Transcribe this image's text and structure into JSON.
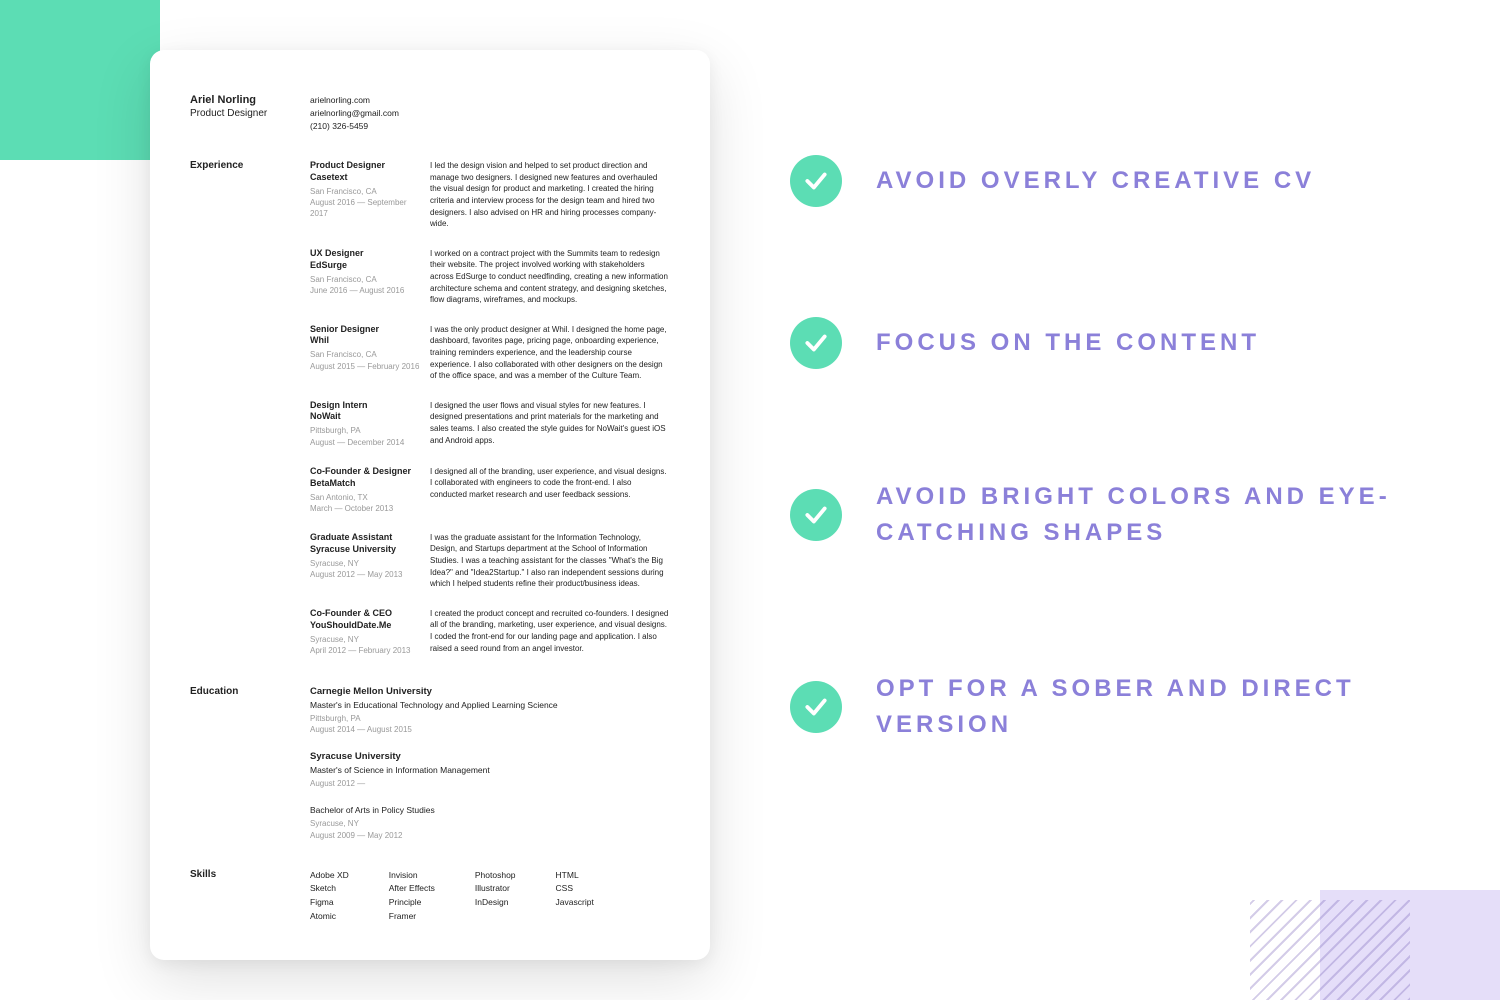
{
  "colors": {
    "accent": "#5CDDB4",
    "tip": "#8B80D9",
    "corner": "#E5DEF9"
  },
  "resume": {
    "name": "Ariel Norling",
    "role": "Product Designer",
    "contact": {
      "site": "arielnorling.com",
      "email": "arielnorling@gmail.com",
      "phone": "(210) 326-5459"
    },
    "sections": {
      "experience_label": "Experience",
      "education_label": "Education",
      "skills_label": "Skills"
    },
    "experience": [
      {
        "title": "Product Designer",
        "company": "Casetext",
        "location": "San Francisco, CA",
        "dates": "August 2016 — September 2017",
        "desc": "I led the design vision and helped to set product direction and manage two designers. I designed new features and overhauled the visual design for product and marketing. I created the hiring criteria and interview process for the design team and hired two designers. I also advised on HR and hiring processes company-wide."
      },
      {
        "title": "UX Designer",
        "company": "EdSurge",
        "location": "San Francisco, CA",
        "dates": "June 2016 — August 2016",
        "desc": "I worked on a contract project with the Summits team to redesign their website. The project involved working with stakeholders across EdSurge to conduct needfinding, creating a new information architecture schema and content strategy, and designing sketches, flow diagrams, wireframes, and mockups."
      },
      {
        "title": "Senior Designer",
        "company": "Whil",
        "location": "San Francisco, CA",
        "dates": "August 2015 — February 2016",
        "desc": "I was the only product designer at Whil. I designed the home page, dashboard, favorites page, pricing page, onboarding experience, training reminders experience, and the leadership course experience. I also collaborated with other designers on the design of the office space, and was a member of the Culture Team."
      },
      {
        "title": "Design Intern",
        "company": "NoWait",
        "location": "Pittsburgh, PA",
        "dates": "August — December 2014",
        "desc": "I designed the user flows and visual styles for new features. I designed presentations and print materials for the marketing and sales teams. I also created the style guides for NoWait's guest iOS and Android apps."
      },
      {
        "title": "Co-Founder & Designer",
        "company": "BetaMatch",
        "location": "San Antonio, TX",
        "dates": "March — October 2013",
        "desc": "I designed all of the branding, user experience, and visual designs. I collaborated with engineers to code the front-end. I also conducted market research and user feedback sessions."
      },
      {
        "title": "Graduate Assistant",
        "company": "Syracuse University",
        "location": "Syracuse, NY",
        "dates": "August 2012 — May 2013",
        "desc": "I was the graduate assistant for the Information Technology, Design, and Startups department at the School of Information Studies. I was a teaching assistant for the classes \"What's the Big Idea?\" and \"Idea2Startup.\" I also ran independent sessions during which I helped students refine their product/business ideas."
      },
      {
        "title": "Co-Founder & CEO",
        "company": "YouShouldDate.Me",
        "location": "Syracuse, NY",
        "dates": "April 2012 — February 2013",
        "desc": "I created the product concept and recruited co-founders. I designed all of the branding, marketing, user experience, and visual designs. I coded the front-end for our landing page and application. I also raised a seed round from an angel investor."
      }
    ],
    "education": [
      {
        "school": "Carnegie Mellon University",
        "degree": "Master's in Educational Technology and Applied Learning Science",
        "location": "Pittsburgh, PA",
        "dates": "August 2014 — August 2015"
      },
      {
        "school": "Syracuse University",
        "degree": "Master's of Science in Information Management",
        "location": "",
        "dates": "August 2012 —"
      },
      {
        "school": "",
        "degree": "Bachelor of Arts in Policy Studies",
        "location": "Syracuse, NY",
        "dates": "August 2009 — May 2012"
      }
    ],
    "skills": [
      [
        "Adobe XD",
        "Sketch",
        "Figma",
        "Atomic"
      ],
      [
        "Invision",
        "After Effects",
        "Principle",
        "Framer"
      ],
      [
        "Photoshop",
        "Illustrator",
        "InDesign"
      ],
      [
        "HTML",
        "CSS",
        "Javascript"
      ]
    ]
  },
  "tips": [
    "Avoid overly creative CV",
    "Focus on the content",
    "Avoid bright colors and eye-catching shapes",
    "Opt for a sober and direct version"
  ]
}
